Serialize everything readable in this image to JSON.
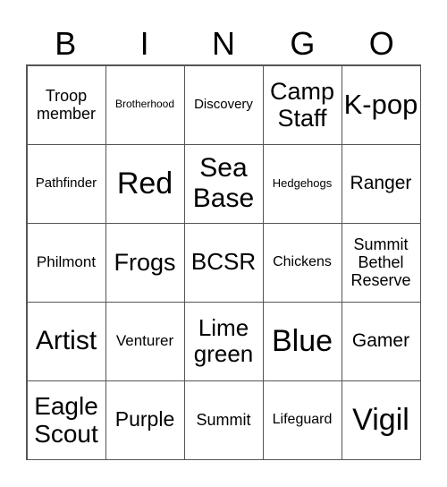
{
  "header": [
    "B",
    "I",
    "N",
    "G",
    "O"
  ],
  "cells": [
    {
      "text": "Troop member",
      "size": 18
    },
    {
      "text": "Brotherhood",
      "size": 12
    },
    {
      "text": "Discovery",
      "size": 15
    },
    {
      "text": "Camp Staff",
      "size": 27
    },
    {
      "text": "K-pop",
      "size": 31
    },
    {
      "text": "Pathfinder",
      "size": 15
    },
    {
      "text": "Red",
      "size": 34
    },
    {
      "text": "Sea Base",
      "size": 30
    },
    {
      "text": "Hedgehogs",
      "size": 13
    },
    {
      "text": "Ranger",
      "size": 21
    },
    {
      "text": "Philmont",
      "size": 17
    },
    {
      "text": "Frogs",
      "size": 27
    },
    {
      "text": "BCSR",
      "size": 26
    },
    {
      "text": "Chickens",
      "size": 16
    },
    {
      "text": "Summit Bethel Reserve",
      "size": 18
    },
    {
      "text": "Artist",
      "size": 30
    },
    {
      "text": "Venturer",
      "size": 17
    },
    {
      "text": "Lime green",
      "size": 26
    },
    {
      "text": "Blue",
      "size": 34
    },
    {
      "text": "Gamer",
      "size": 21
    },
    {
      "text": "Eagle Scout",
      "size": 28
    },
    {
      "text": "Purple",
      "size": 23
    },
    {
      "text": "Summit",
      "size": 18
    },
    {
      "text": "Lifeguard",
      "size": 16
    },
    {
      "text": "Vigil",
      "size": 34
    }
  ]
}
